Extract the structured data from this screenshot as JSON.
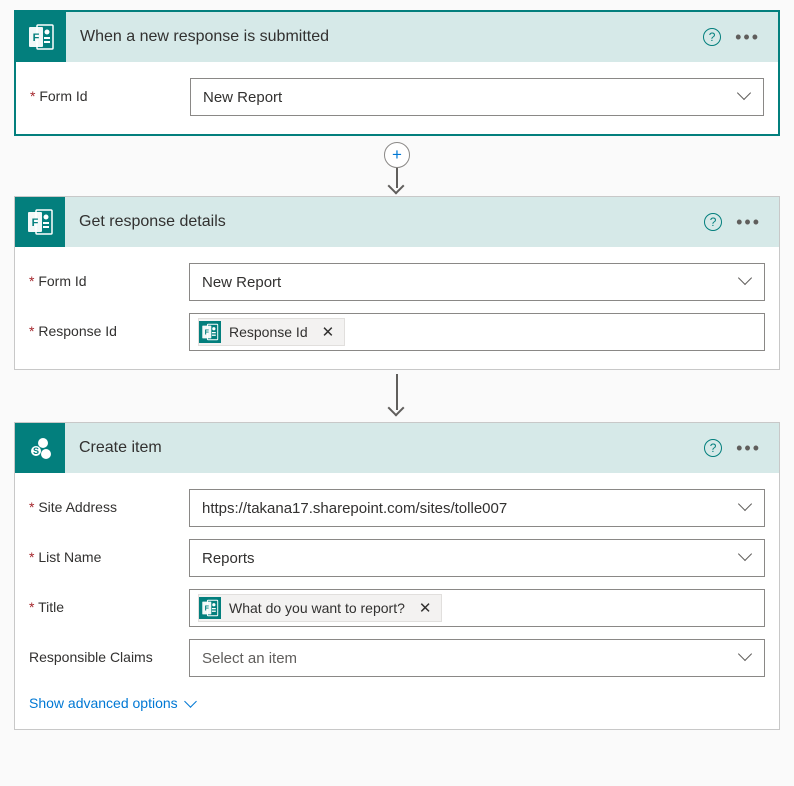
{
  "flow": {
    "steps": [
      {
        "title": "When a new response is submitted",
        "brand": "forms",
        "fields": [
          {
            "label": "Form Id",
            "required": true,
            "type": "select",
            "value": "New Report"
          }
        ]
      },
      {
        "title": "Get response details",
        "brand": "forms",
        "fields": [
          {
            "label": "Form Id",
            "required": true,
            "type": "select",
            "value": "New Report"
          },
          {
            "label": "Response Id",
            "required": true,
            "type": "token",
            "token": "Response Id",
            "tokenBrand": "forms"
          }
        ]
      },
      {
        "title": "Create item",
        "brand": "sharepoint",
        "fields": [
          {
            "label": "Site Address",
            "required": true,
            "type": "select",
            "value": "https://takana17.sharepoint.com/sites/tolle007"
          },
          {
            "label": "List Name",
            "required": true,
            "type": "select",
            "value": "Reports"
          },
          {
            "label": "Title",
            "required": true,
            "type": "token",
            "token": "What do you want to report?",
            "tokenBrand": "forms"
          },
          {
            "label": "Responsible Claims",
            "required": false,
            "type": "select",
            "placeholder": "Select an item"
          }
        ],
        "advancedLink": "Show advanced options"
      }
    ],
    "plusLabel": "+"
  }
}
